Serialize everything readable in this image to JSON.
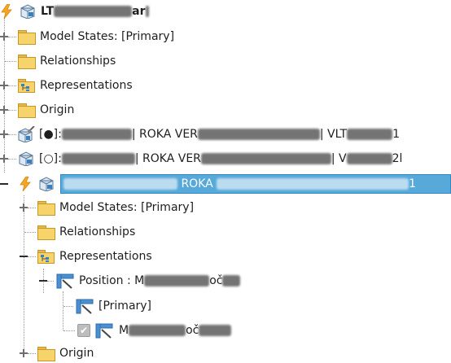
{
  "tree": {
    "top_node": {
      "prefix": "LT",
      "suffix": "ar"
    },
    "items_level1": [
      {
        "label": "Model States: [Primary]"
      },
      {
        "label": "Relationships"
      },
      {
        "label": "Representations"
      },
      {
        "label": "Origin"
      }
    ],
    "occurrence1": {
      "prefix": "[●]:",
      "mid": "| ROKA VER",
      "tail": "| VLT",
      "end": "1"
    },
    "occurrence2": {
      "prefix": "[○]:",
      "mid": "| ROKA VER",
      "tail": "| V",
      "end": "2l"
    },
    "selected_node": {
      "mid": "ROKA",
      "end": "1"
    },
    "items_level2": [
      {
        "label": "Model States: [Primary]"
      },
      {
        "label": "Relationships"
      },
      {
        "label": "Representations"
      }
    ],
    "position": {
      "label": "Position : M",
      "suffix": "oč"
    },
    "position_children": [
      {
        "label": "[Primary]"
      },
      {
        "label": "M",
        "suffix": "oč",
        "checked": "✔"
      }
    ],
    "last_item": {
      "label": "Origin"
    }
  },
  "colors": {
    "selection": "#56a9d9",
    "folder": "#f7d36b"
  },
  "icons": {
    "lightning": "lightning-icon",
    "part": "part-icon",
    "folder": "folder-icon",
    "position": "position-icon"
  }
}
